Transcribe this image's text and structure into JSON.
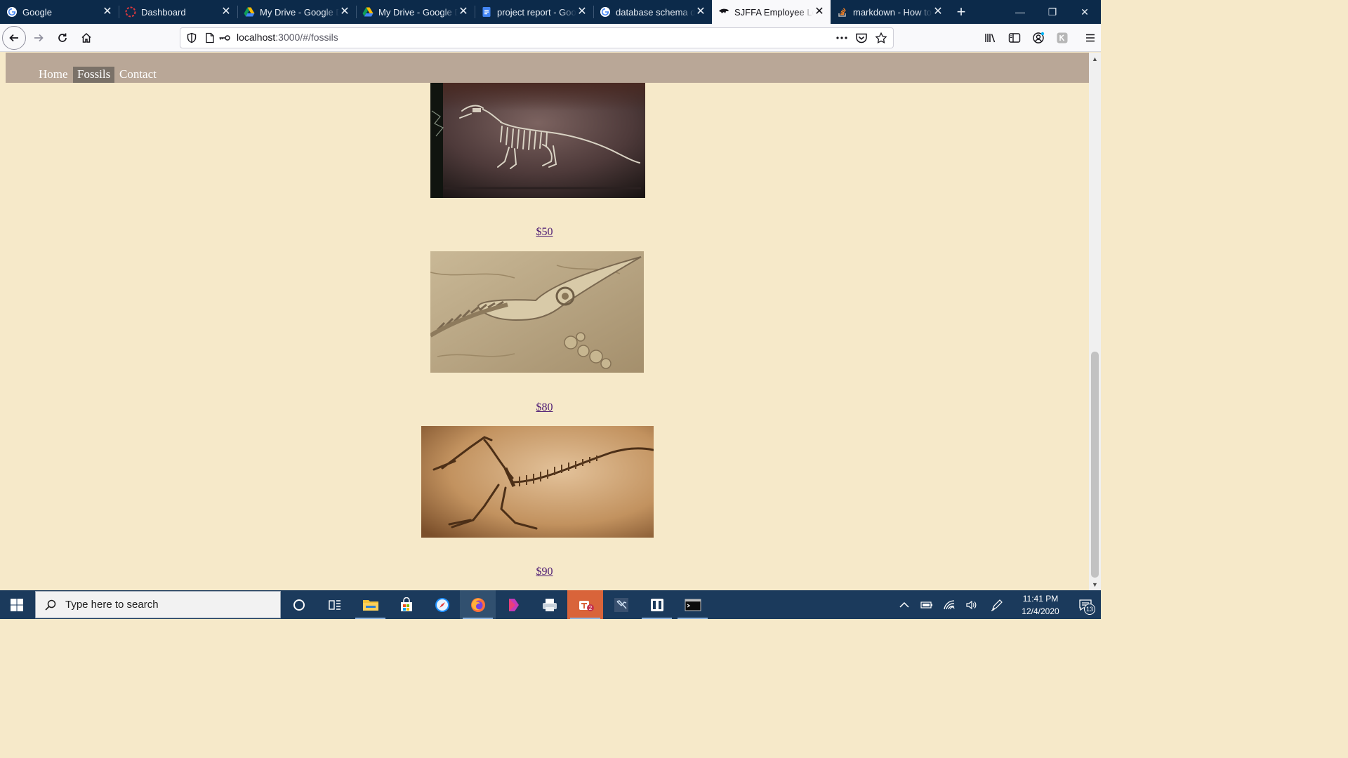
{
  "browser": {
    "tabs": [
      {
        "title": "Google",
        "favicon": "google-icon",
        "active": false
      },
      {
        "title": "Dashboard",
        "favicon": "dashboard-icon",
        "active": false
      },
      {
        "title": "My Drive - Google Drive",
        "favicon": "google-drive-icon",
        "active": false
      },
      {
        "title": "My Drive - Google Drive",
        "favicon": "google-drive-icon",
        "active": false
      },
      {
        "title": "project report - Google Docs",
        "favicon": "google-docs-icon",
        "active": false
      },
      {
        "title": "database schema diagram",
        "favicon": "google-icon",
        "active": false
      },
      {
        "title": "SJFFA Employee Login",
        "favicon": "dinosaur-icon",
        "active": true
      },
      {
        "title": "markdown - How to",
        "favicon": "stackoverflow-icon",
        "active": false
      }
    ],
    "tab_close_glyph": "✕",
    "new_tab_glyph": "+",
    "window_controls": {
      "minimize": "—",
      "restore": "❐",
      "close": "✕"
    },
    "url": {
      "host": "localhost",
      "rest": ":3000/#/fossils"
    }
  },
  "site": {
    "nav": [
      {
        "label": "Home",
        "active": false
      },
      {
        "label": "Fossils",
        "active": true
      },
      {
        "label": "Contact",
        "active": false
      }
    ],
    "fossils": [
      {
        "image": "fossil-skeleton-dinosaur",
        "price": "$50"
      },
      {
        "image": "fossil-ichthyosaur-skull",
        "price": "$80"
      },
      {
        "image": "fossil-archaeopteryx",
        "price": "$90"
      }
    ]
  },
  "taskbar": {
    "search_placeholder": "Type here to search",
    "apps": [
      "cortana-icon",
      "task-view-icon",
      "file-explorer-icon",
      "store-icon",
      "safari-icon",
      "firefox-icon",
      "powerapps-icon",
      "printer-icon",
      "teams-icon",
      "visual-studio-icon",
      "sourcetree-icon",
      "terminal-icon"
    ],
    "clock": {
      "time": "11:41 PM",
      "date": "12/4/2020"
    },
    "notification_count": "13"
  },
  "colors": {
    "page_background": "#f6e9c9",
    "site_nav": "#b9a797",
    "site_nav_active": "#7a7168",
    "price_link": "#4c1a73",
    "tabstrip": "#0c2a4a",
    "taskbar": "#1b3a5c"
  }
}
